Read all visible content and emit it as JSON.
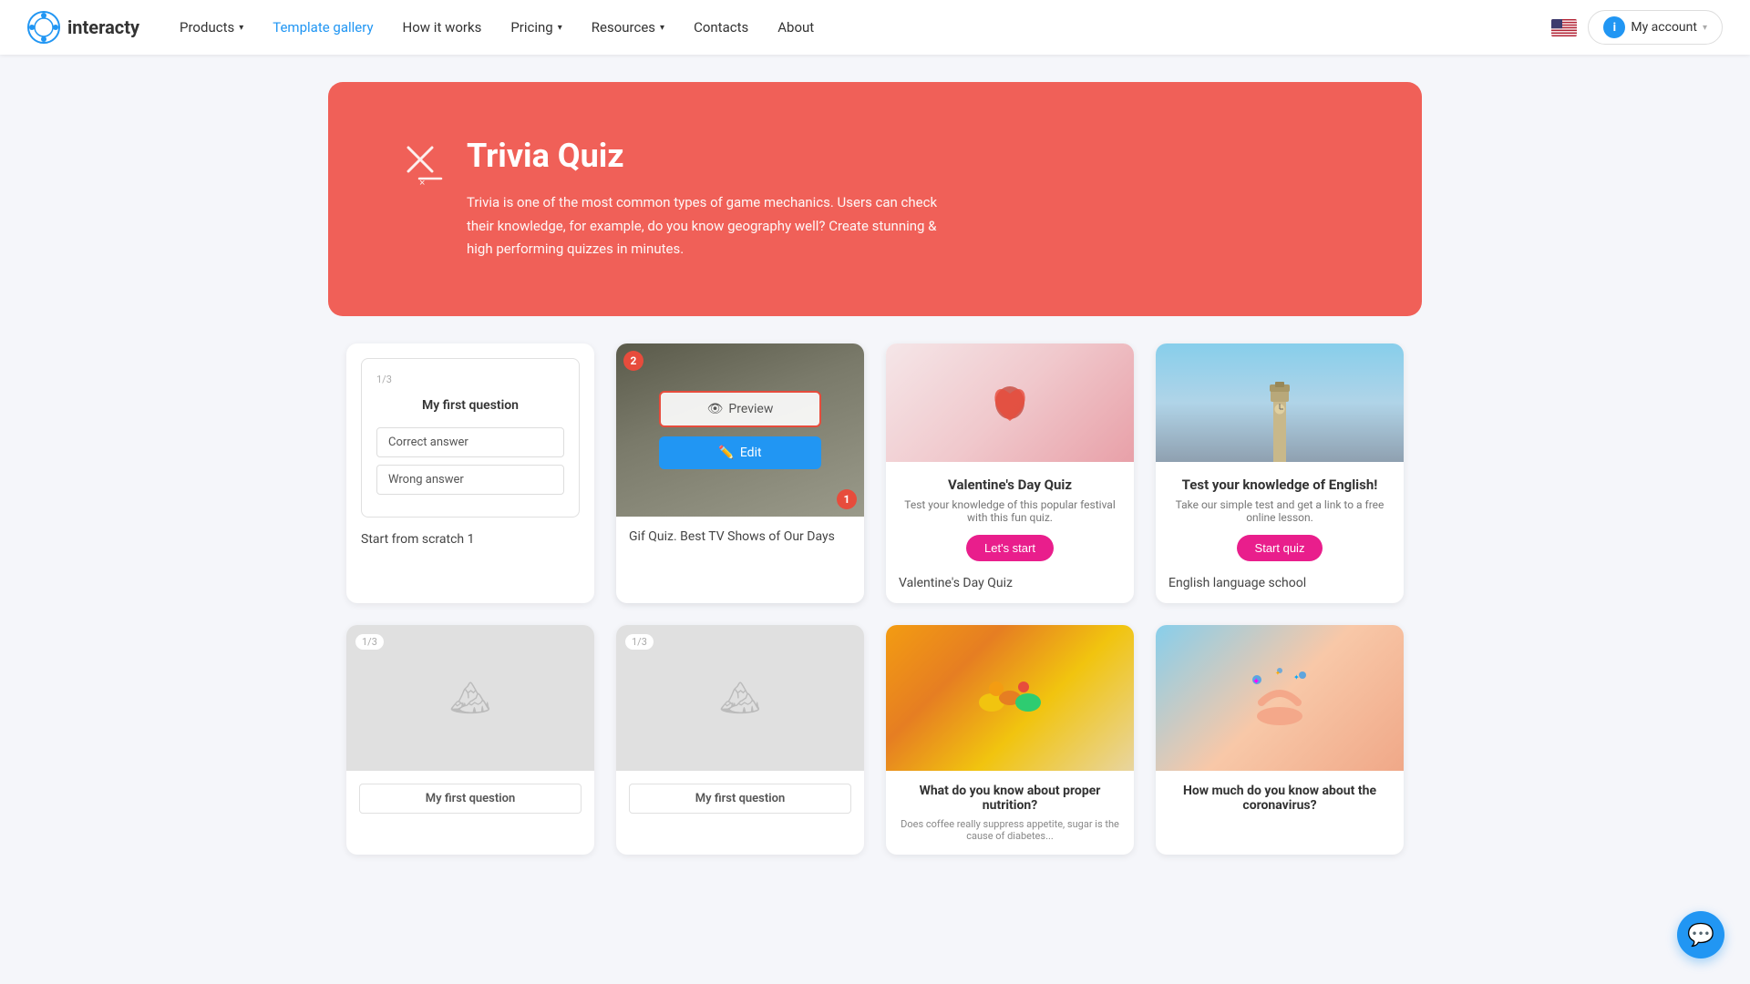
{
  "nav": {
    "logo_text": "interacty",
    "items": [
      {
        "label": "Products",
        "has_caret": true,
        "active": false
      },
      {
        "label": "Template gallery",
        "has_caret": false,
        "active": true
      },
      {
        "label": "How it works",
        "has_caret": false,
        "active": false
      },
      {
        "label": "Pricing",
        "has_caret": true,
        "active": false
      },
      {
        "label": "Resources",
        "has_caret": true,
        "active": false
      },
      {
        "label": "Contacts",
        "has_caret": false,
        "active": false
      },
      {
        "label": "About",
        "has_caret": false,
        "active": false
      }
    ],
    "my_account": "My account"
  },
  "hero": {
    "title": "Trivia Quiz",
    "description": "Trivia is one of the most common types of game mechanics. Users can check their knowledge, for example, do you know geography well? Create stunning & high performing quizzes in minutes."
  },
  "cards_row1": [
    {
      "id": "scratch1",
      "type": "scratch",
      "counter": "1/3",
      "question": "My first question",
      "answer1": "Correct answer",
      "answer2": "Wrong answer",
      "label": "Start from scratch 1"
    },
    {
      "id": "gif-tv",
      "type": "gif",
      "label": "Gif Quiz. Best TV Shows of Our Days"
    },
    {
      "id": "valentines",
      "type": "quiz",
      "title": "Valentine's Day Quiz",
      "desc": "Test your knowledge of this popular festival with this fun quiz.",
      "btn": "Let's start",
      "label": "Valentine's Day Quiz"
    },
    {
      "id": "english",
      "type": "quiz",
      "title": "Test your knowledge of English!",
      "desc": "Take our simple test and get a link to a free online lesson.",
      "btn": "Start quiz",
      "label": "English language school"
    }
  ],
  "cards_row2": [
    {
      "id": "scratch2",
      "type": "placeholder",
      "counter": "1/3",
      "question": "My first question",
      "label": ""
    },
    {
      "id": "scratch3",
      "type": "placeholder",
      "counter": "1/3",
      "question": "My first question",
      "label": ""
    },
    {
      "id": "food",
      "type": "photo",
      "title": "What do you know about proper nutrition?",
      "desc": "Does coffee really suppress appetite, sugar is the cause of diabetes...",
      "label": "What do you know about proper nutrition?"
    },
    {
      "id": "corona",
      "type": "photo",
      "title": "How much do you know about the coronavirus?",
      "desc": "",
      "label": "How much do you know about the coronavirus?"
    }
  ],
  "chat": {
    "icon": "💬"
  },
  "preview_label": "Preview",
  "edit_label": "Edit"
}
